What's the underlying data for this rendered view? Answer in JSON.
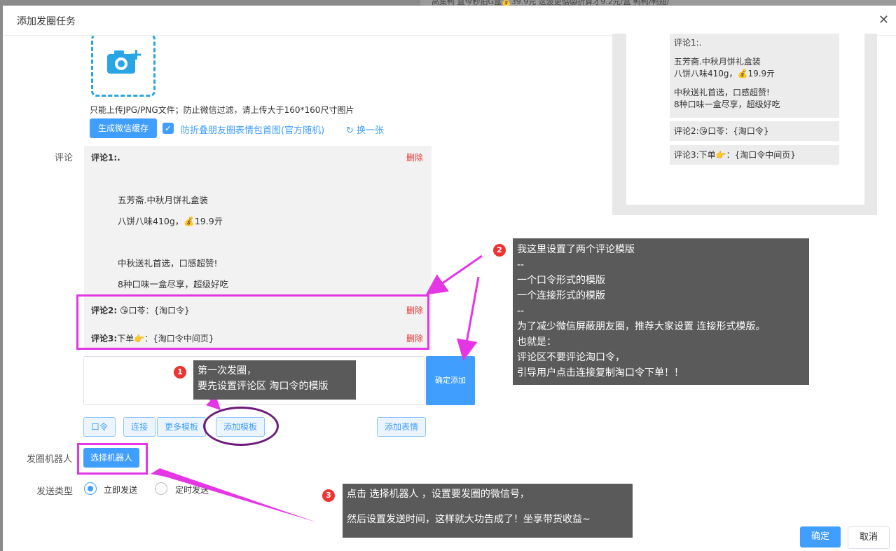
{
  "background_text": "高集鸭 直今秒拍G盒💰39.9元 这波更惦😱折算才9.2元/盒 鸭鸭/鸭翅/",
  "dialog": {
    "title": "添加发圈任务",
    "close": "✕"
  },
  "upload": {
    "hint": "只能上传JPG/PNG文件；防止微信过滤，请上传大于160*160尺寸图片",
    "gen_button": "生成微信缓存",
    "checkbox_label": "防折叠朋友圈表情包首图(官方随机)",
    "refresh_label": "换一张"
  },
  "comments": {
    "label": "评论",
    "c1_title": "评论1:.",
    "c1_lines": [
      "五芳斋.中秋月饼礼盒装",
      "八饼八味410g，💰19.9亓",
      "中秋送礼首选，口感超赞!",
      "8种口味一盒尽享，超级好吃"
    ],
    "c2_prefix": "评论2:",
    "c2_text": "😘口苓：{淘口令}",
    "c3_prefix": "评论3:",
    "c3_text": "下单👉：{淘口令中间页}",
    "delete": "删除"
  },
  "composer": {
    "confirm_add": "确定添加",
    "buttons": [
      "口令",
      "连接",
      "更多模板",
      "添加模板"
    ],
    "add_emoji": "添加表情"
  },
  "robot": {
    "label": "发圈机器人",
    "button": "选择机器人"
  },
  "send_type": {
    "label": "发送类型",
    "options": [
      "立即发送",
      "定时发送"
    ],
    "selected": "立即发送"
  },
  "preview": {
    "c1": "评论1:.",
    "line1": "五芳斋.中秋月饼礼盒装",
    "line2": "八饼八味410g，💰19.9亓",
    "line3": "中秋送礼首选，口感超赞!",
    "line4": "8种口味一盒尽享，超级好吃",
    "c2": "评论2:😘口苓：{淘口令}",
    "c3": "评论3:下单👉：{淘口令中间页}"
  },
  "callouts": {
    "c1_num": "1",
    "c1_lines": [
      "第一次发圈，",
      "要先设置评论区 淘口令的模版"
    ],
    "c2_num": "2",
    "c2_lines": [
      "我这里设置了两个评论模版",
      "--",
      "一个口令形式的模版",
      "一个连接形式的模版",
      "--",
      "为了减少微信屏蔽朋友圈，推荐大家设置 连接形式模版。",
      "也就是：",
      "评论区不要评论淘口令，",
      "引导用户点击连接复制淘口令下单！！"
    ],
    "c3_num": "3",
    "c3_lines": [
      "点击  选择机器人 ，设置要发圈的微信号，",
      "",
      "然后设置发送时间，这样就大功告成了！坐享带货收益~"
    ]
  },
  "footer": {
    "ok": "确定",
    "cancel": "取消"
  },
  "colors": {
    "primary": "#409eff",
    "highlight": "#e536e5",
    "callout_bg": "#5a5a5a",
    "delete": "#e33333"
  }
}
